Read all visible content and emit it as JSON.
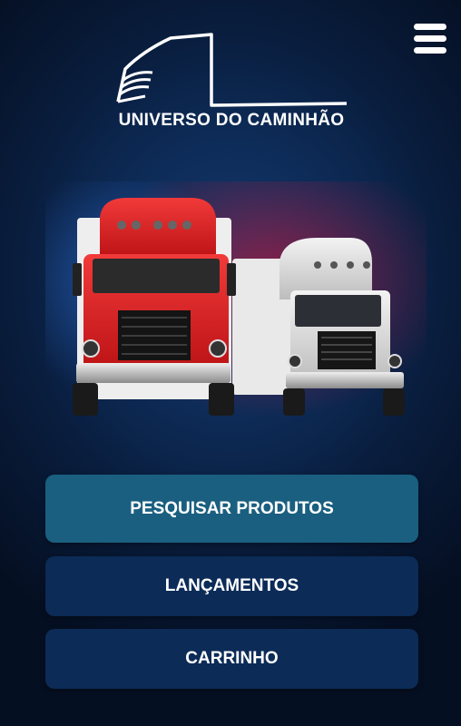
{
  "app": {
    "brand_name": "UNIVERSO DO CAMINHÃO"
  },
  "header": {
    "menu_icon": "hamburger-menu-icon"
  },
  "hero": {
    "image": "red-and-white-semi-trucks"
  },
  "buttons": {
    "search_products": "PESQUISAR PRODUTOS",
    "launches": "LANÇAMENTOS",
    "cart": "CARRINHO"
  },
  "colors": {
    "background": "#0d2a55",
    "primary_button": "#1a5f80",
    "secondary_button": "#0c2b57",
    "text": "#ffffff"
  }
}
